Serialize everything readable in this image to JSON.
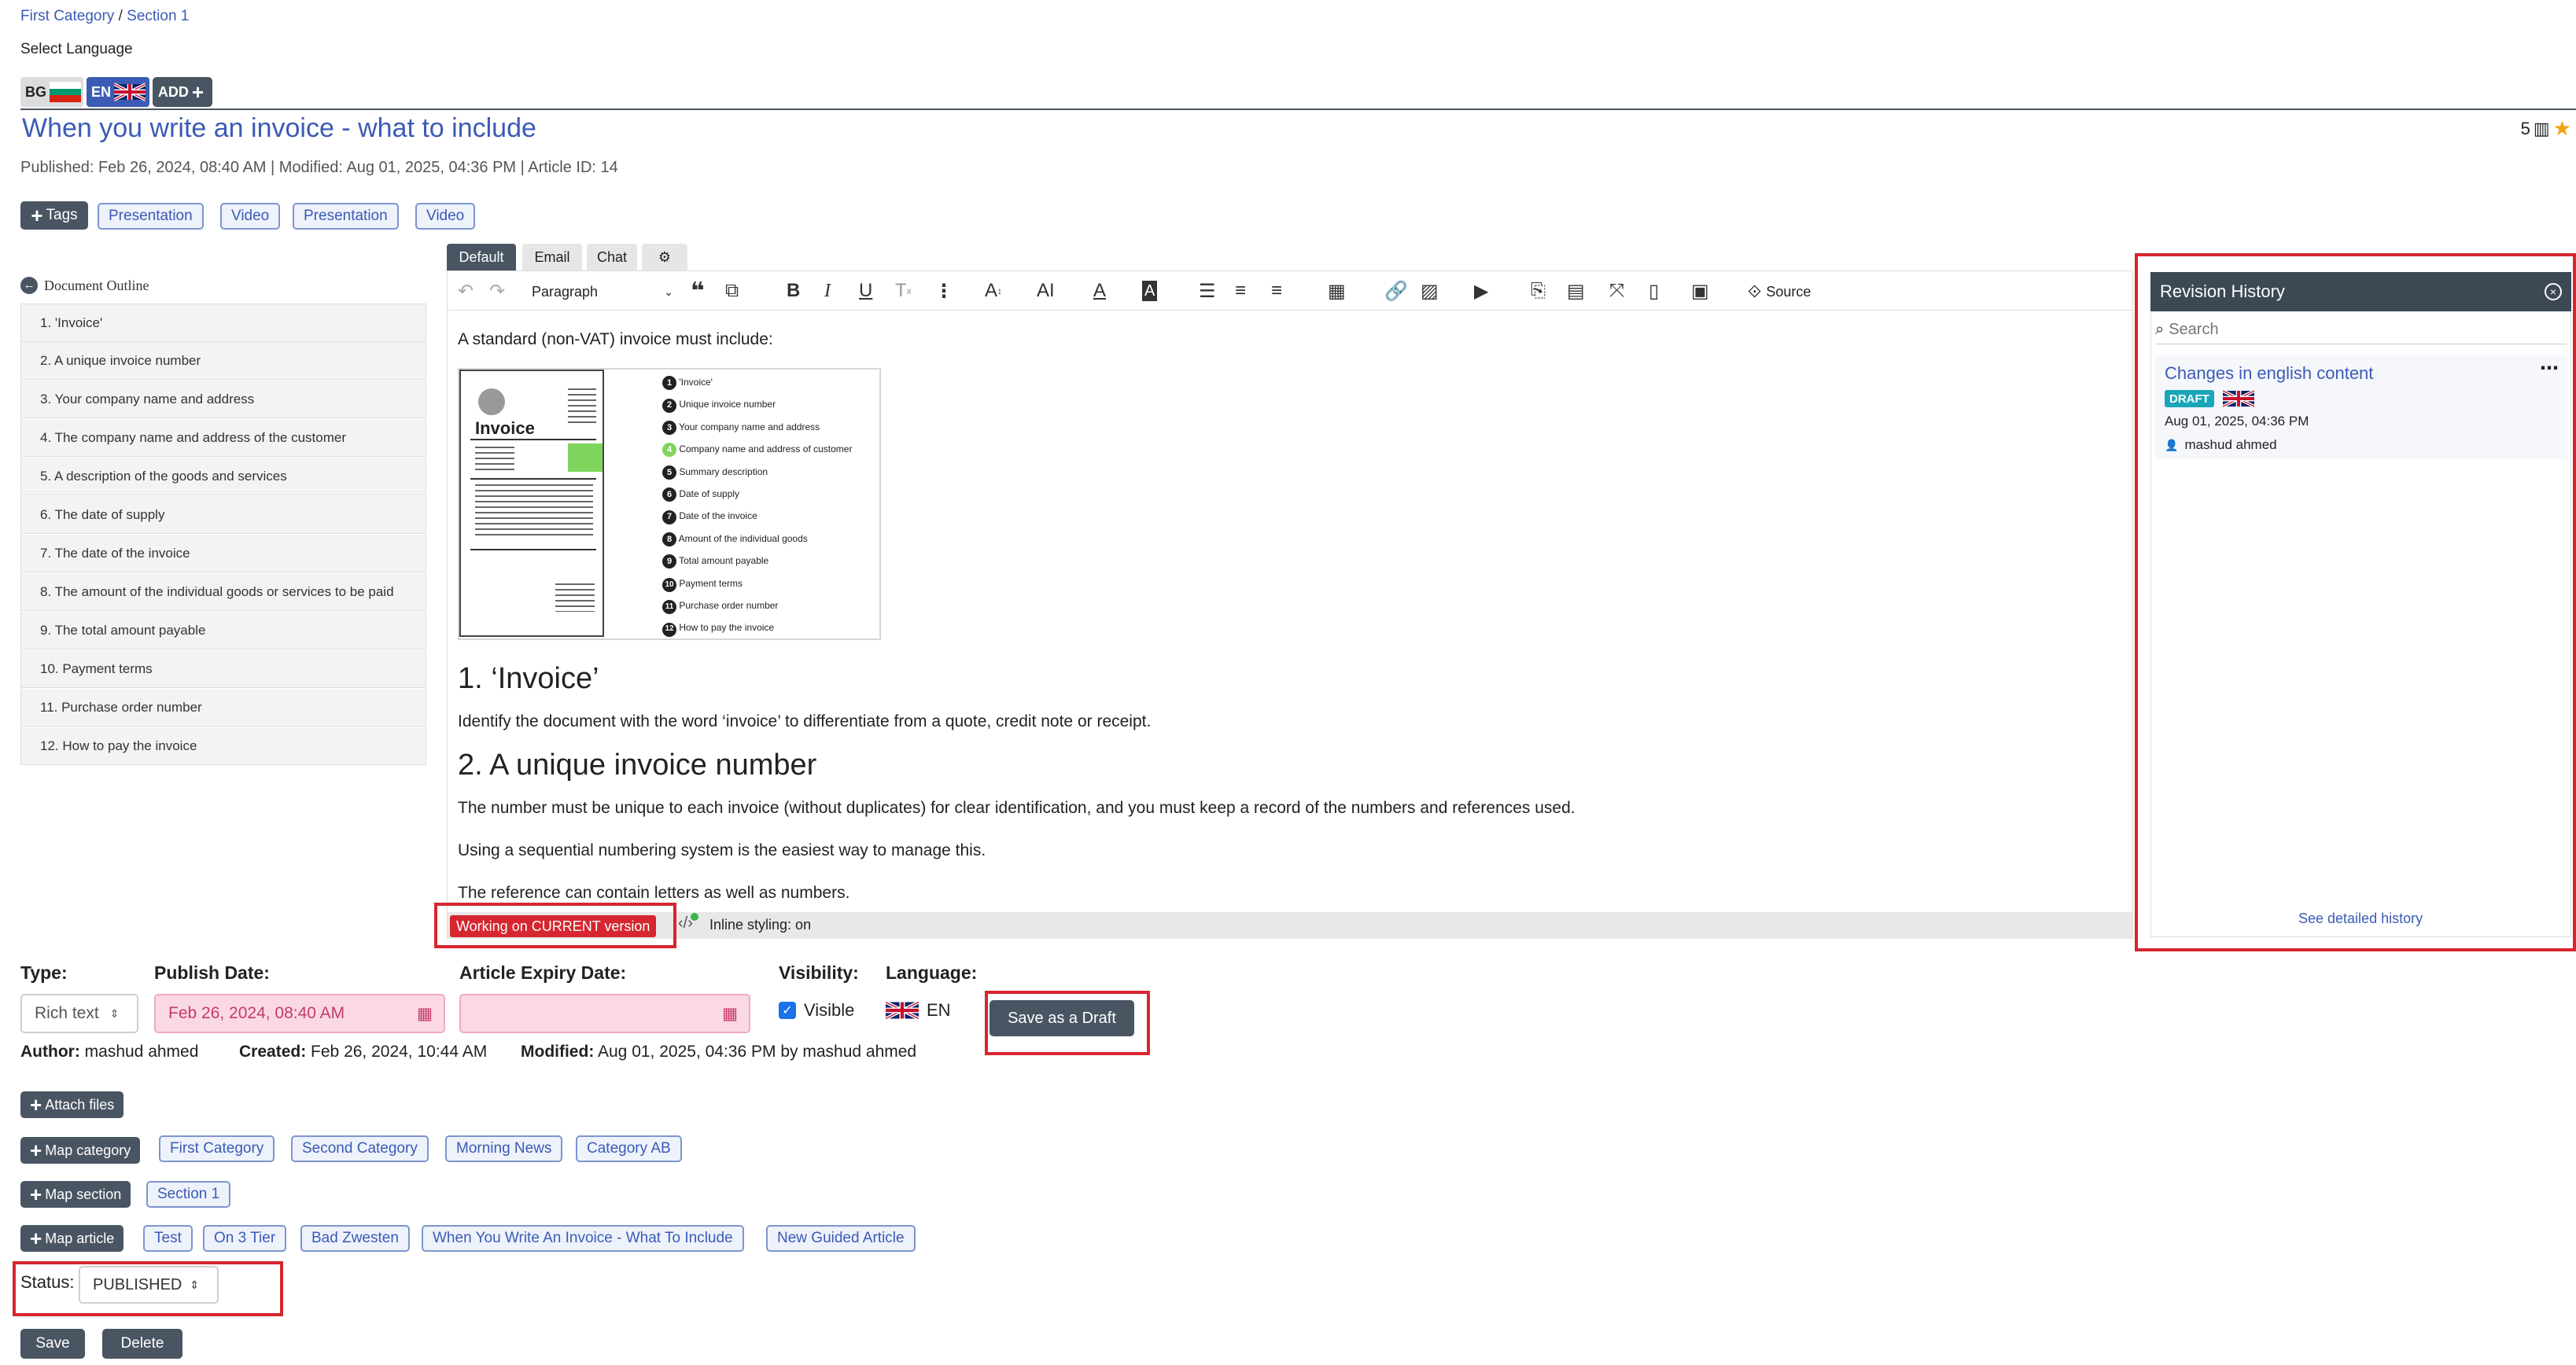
{
  "breadcrumb": {
    "first": "First Category",
    "separator": "/",
    "second": "Section 1"
  },
  "language": {
    "select_label": "Select Language",
    "tabs": [
      {
        "code": "BG"
      },
      {
        "code": "EN"
      }
    ],
    "add_label": "ADD"
  },
  "article": {
    "title": "When you write an invoice - what to include",
    "meta": "Published: Feb 26, 2024, 08:40 AM | Modified: Aug 01, 2025, 04:36 PM | Article ID: 14",
    "rating_count": "5"
  },
  "tags": {
    "button_label": "Tags",
    "items": [
      "Presentation",
      "Video",
      "Presentation",
      "Video"
    ]
  },
  "outline": {
    "title": "Document Outline",
    "items": [
      "1. 'Invoice'",
      "2. A unique invoice number",
      "3. Your company name and address",
      "4. The company name and address of the customer",
      "5. A description of the goods and services",
      "6. The date of supply",
      "7. The date of the invoice",
      "8. The amount of the individual goods or services to be paid",
      "9. The total amount payable",
      "10. Payment terms",
      "11. Purchase order number",
      "12. How to pay the invoice"
    ]
  },
  "editor": {
    "tabs": [
      "Default",
      "Email",
      "Chat"
    ],
    "paragraph_select": "Paragraph",
    "source_label": "Source",
    "intro": "A standard (non-VAT) invoice must include:",
    "image": {
      "heading": "Invoice",
      "items": [
        "'Invoice'",
        "Unique invoice number",
        "Your company name and address",
        "Company name and address of customer",
        "Summary description",
        "Date of supply",
        "Date of the invoice",
        "Amount of the individual goods",
        "Total amount payable",
        "Payment terms",
        "Purchase order number",
        "How to pay the invoice"
      ]
    },
    "h1": "1. ‘Invoice’",
    "p1": "Identify the document with the word ‘invoice’ to differentiate from a quote, credit note or receipt.",
    "h2": "2. A unique invoice number",
    "p2": "The number must be unique to each invoice (without duplicates) for clear identification, and you must keep a record of the numbers and references used.",
    "p3": "Using a sequential numbering system is the easiest way to manage this.",
    "p4": "The reference can contain letters as well as numbers.",
    "status_badge": "Working on CURRENT version",
    "inline_styling": "Inline styling: on"
  },
  "revision": {
    "title": "Revision History",
    "search_placeholder": "Search",
    "entry": {
      "title": "Changes in english content",
      "badge": "DRAFT",
      "date": "Aug 01, 2025, 04:36 PM",
      "author": "mashud ahmed"
    },
    "detailed_link": "See detailed history"
  },
  "form": {
    "type_label": "Type:",
    "type_value": "Rich text",
    "publish_label": "Publish Date:",
    "publish_value": "Feb 26, 2024, 08:40 AM",
    "expiry_label": "Article Expiry Date:",
    "visibility_label": "Visibility:",
    "visible_label": "Visible",
    "language_label": "Language:",
    "language_value": "EN",
    "save_draft": "Save as a Draft",
    "author_label": "Author:",
    "author_value": "mashud ahmed",
    "created_label": "Created:",
    "created_value": "Feb 26, 2024, 10:44 AM",
    "modified_label": "Modified:",
    "modified_value": "Aug 01, 2025, 04:36 PM by mashud ahmed"
  },
  "attach": {
    "label": "Attach files"
  },
  "map_category": {
    "label": "Map category",
    "items": [
      "First Category",
      "Second Category",
      "Morning News",
      "Category AB"
    ]
  },
  "map_section": {
    "label": "Map section",
    "items": [
      "Section 1"
    ]
  },
  "map_article": {
    "label": "Map article",
    "items": [
      "Test",
      "On 3 Tier",
      "Bad Zwesten",
      "When You Write An Invoice - What To Include",
      "New Guided Article"
    ]
  },
  "status": {
    "label": "Status:",
    "value": "PUBLISHED"
  },
  "actions": {
    "save": "Save",
    "delete": "Delete"
  },
  "colors": {
    "accent": "#3b5bb5",
    "dark": "#4a5563",
    "highlight": "#d6262f",
    "draft_badge": "#1aa5b8"
  }
}
